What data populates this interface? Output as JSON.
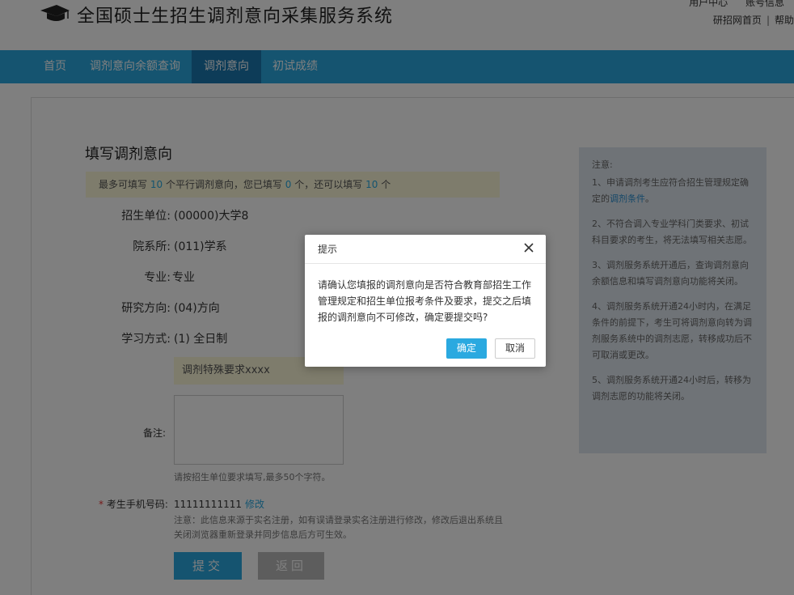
{
  "header": {
    "title": "全国硕士生招生调剂意向采集服务系统",
    "top_links_1": [
      "用户中心",
      "账号信息"
    ],
    "top_links_2": [
      "研招网首页",
      "帮助"
    ]
  },
  "nav": {
    "items": [
      {
        "label": "首页",
        "active": false
      },
      {
        "label": "调剂意向余额查询",
        "active": false
      },
      {
        "label": "调剂意向",
        "active": true
      },
      {
        "label": "初试成绩",
        "active": false
      }
    ]
  },
  "form": {
    "title": "填写调剂意向",
    "info": {
      "prefix": "最多可填写",
      "max": "10",
      "mid1": "个平行调剂意向，您已填写",
      "filled": "0",
      "mid2": "个，还可以填写",
      "remaining": "10",
      "suffix": "个"
    },
    "fields": [
      {
        "label": "招生单位:",
        "value": "(00000)大学8"
      },
      {
        "label": "院系所:",
        "value": "(011)学系"
      },
      {
        "label": "专业:",
        "value": "专业"
      },
      {
        "label": "研究方向:",
        "value": "(04)方向"
      },
      {
        "label": "学习方式:",
        "value": "(1) 全日制"
      }
    ],
    "special_requirement": "调剂特殊要求xxxx",
    "remark_label": "备注:",
    "remark_hint": "请按招生单位要求填写,最多50个字符。",
    "phone_label_star": "*",
    "phone_label": "考生手机号码:",
    "phone_value": "11111111111",
    "phone_edit": "修改",
    "note": "注意：此信息来源于实名注册，如有误请登录实名注册进行修改，修改后退出系统且关闭浏览器重新登录并同步信息后方可生效。",
    "submit_label": "提交",
    "back_label": "返回"
  },
  "side_notes": {
    "title": "注意:",
    "item1_prefix": "1、申请调剂考生应符合招生管理规定确定的",
    "item1_link": "调剂条件",
    "item1_suffix": "。",
    "item2": "2、不符合调入专业学科门类要求、初试科目要求的考生，将无法填写相关志愿。",
    "item3": "3、调剂服务系统开通后，查询调剂意向余额信息和填写调剂意向功能将关闭。",
    "item4": "4、调剂服务系统开通24小时内，在满足条件的前提下，考生可将调剂意向转为调剂服务系统中的调剂志愿，转移成功后不可取消或更改。",
    "item5": "5、调剂服务系统开通24小时后，转移为调剂志愿的功能将关闭。"
  },
  "dialog": {
    "title": "提示",
    "message": "请确认您填报的调剂意向是否符合教育部招生工作管理规定和招生单位报考条件及要求，提交之后填报的调剂意向不可修改，确定要提交吗?",
    "ok_label": "确定",
    "cancel_label": "取消"
  },
  "colors": {
    "accent": "#2aa9e0",
    "nav_active": "#1b78b0",
    "info_bg": "#fcf8d9",
    "side_bg": "#dfe7ee"
  }
}
